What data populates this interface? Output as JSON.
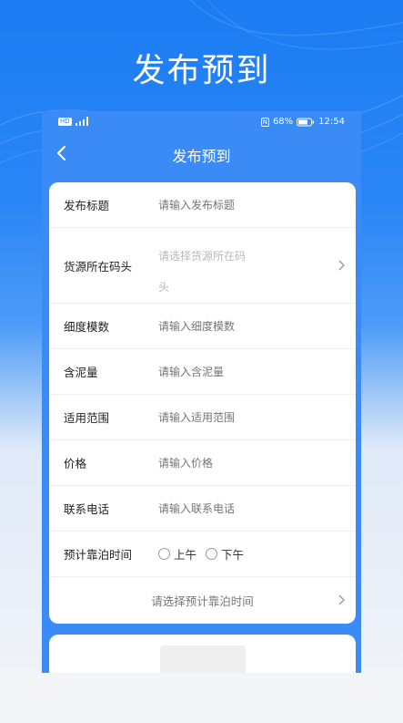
{
  "promo": {
    "title": "发布预到"
  },
  "status_bar": {
    "left_icons": [
      "hd-icon",
      "signal-icon"
    ],
    "hd_text": "HD",
    "nfc_text": "N",
    "battery": "68%",
    "time": "12:54"
  },
  "nav": {
    "title": "发布预到"
  },
  "form": {
    "title": {
      "label": "发布标题",
      "placeholder": "请输入发布标题"
    },
    "dock": {
      "label": "货源所在码头",
      "placeholder_line1": "请选择货源所在码",
      "placeholder_line2": "头"
    },
    "fineness": {
      "label": "细度模数",
      "placeholder": "请输入细度模数"
    },
    "mud": {
      "label": "含泥量",
      "placeholder": "请输入含泥量"
    },
    "scope": {
      "label": "适用范围",
      "placeholder": "请输入适用范围"
    },
    "price": {
      "label": "价格",
      "placeholder": "请输入价格"
    },
    "phone": {
      "label": "联系电话",
      "placeholder": "请输入联系电话"
    },
    "berth_time": {
      "label": "预计靠泊时间",
      "options": [
        "上午",
        "下午"
      ]
    },
    "berth_select": {
      "text": "请选择预计靠泊时间"
    }
  },
  "colors": {
    "primary": "#2a86f6",
    "placeholder": "#b9b9b9"
  }
}
